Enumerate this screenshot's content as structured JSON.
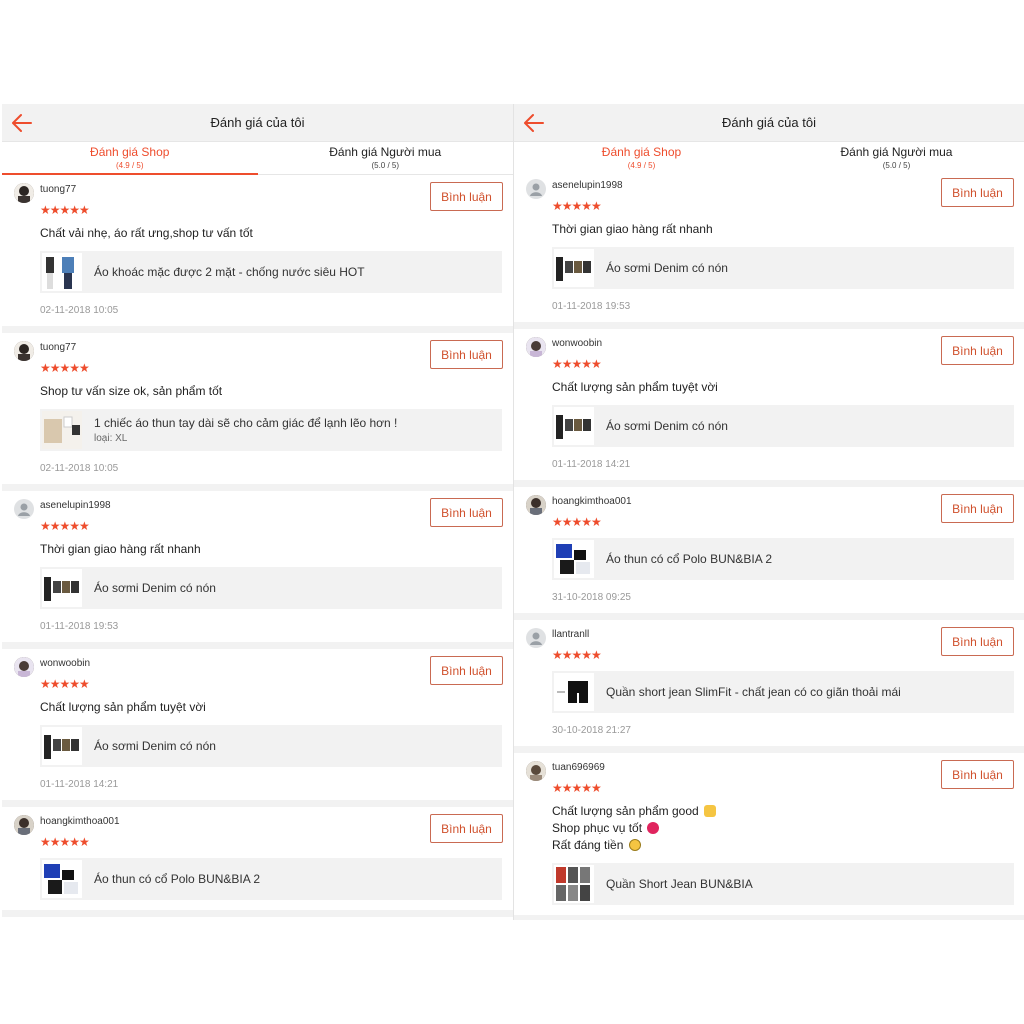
{
  "colors": {
    "accent": "#ee4d2d",
    "star": "#ee4d2d",
    "divider": "#f2f2f2"
  },
  "screens": [
    {
      "header": {
        "title": "Đánh giá của tôi"
      },
      "tabs": [
        {
          "label": "Đánh giá Shop",
          "score": "(4.9 / 5)",
          "active": true
        },
        {
          "label": "Đánh giá Người mua",
          "score": "(5.0 / 5)",
          "active": false
        }
      ],
      "reviews": [
        {
          "user": "tuong77",
          "stars": "★★★★★",
          "comment": [
            "Chất vải nhẹ, áo rất ưng,shop tư vấn tốt"
          ],
          "product": "Áo khoác mặc được 2 mặt - chống nước siêu HOT",
          "variant": "",
          "date": "02-11-2018 10:05",
          "button": "Bình luận"
        },
        {
          "user": "tuong77",
          "stars": "★★★★★",
          "comment": [
            "Shop tư vấn size ok, sản phẩm tốt"
          ],
          "product": "1 chiếc áo thun tay dài sẽ cho cảm giác để lạnh lẽo hơn !",
          "variant": "loại: XL",
          "date": "02-11-2018 10:05",
          "button": "Bình luận"
        },
        {
          "user": "asenelupin1998",
          "stars": "★★★★★",
          "comment": [
            "Thời gian giao hàng rất nhanh"
          ],
          "product": "Áo sơmi Denim có nón",
          "variant": "",
          "date": "01-11-2018 19:53",
          "button": "Bình luận"
        },
        {
          "user": "wonwoobin",
          "stars": "★★★★★",
          "comment": [
            "Chất lượng sản phẩm tuyệt vời"
          ],
          "product": "Áo sơmi Denim có nón",
          "variant": "",
          "date": "01-11-2018 14:21",
          "button": "Bình luận"
        },
        {
          "user": "hoangkimthoa001",
          "stars": "★★★★★",
          "comment": [],
          "product": "Áo thun có cổ Polo BUN&BIA 2",
          "variant": "",
          "date": "",
          "button": "Bình luận"
        }
      ]
    },
    {
      "header": {
        "title": "Đánh giá của tôi"
      },
      "tabs": [
        {
          "label": "Đánh giá Shop",
          "score": "(4.9 / 5)",
          "active": true
        },
        {
          "label": "Đánh giá Người mua",
          "score": "(5.0 / 5)",
          "active": false
        }
      ],
      "reviews": [
        {
          "user": "asenelupin1998",
          "stars": "★★★★★",
          "comment": [
            "Thời gian giao hàng rất nhanh"
          ],
          "product": "Áo sơmi Denim có nón",
          "variant": "",
          "date": "01-11-2018 19:53",
          "button": "Bình luận"
        },
        {
          "user": "wonwoobin",
          "stars": "★★★★★",
          "comment": [
            "Chất lượng sản phẩm tuyệt vời"
          ],
          "product": "Áo sơmi Denim có nón",
          "variant": "",
          "date": "01-11-2018 14:21",
          "button": "Bình luận"
        },
        {
          "user": "hoangkimthoa001",
          "stars": "★★★★★",
          "comment": [],
          "product": "Áo thun có cổ Polo BUN&BIA 2",
          "variant": "",
          "date": "31-10-2018 09:25",
          "button": "Bình luận"
        },
        {
          "user": "llantranll",
          "stars": "★★★★★",
          "comment": [],
          "product": "Quần short jean SlimFit - chất jean có co giãn thoải mái",
          "variant": "",
          "date": "30-10-2018 21:27",
          "button": "Bình luận"
        },
        {
          "user": "tuan696969",
          "stars": "★★★★★",
          "comment": [
            "Chất lượng sản phẩm good",
            "Shop phục vụ tốt",
            "Rất đáng tiền"
          ],
          "product": "Quần Short Jean BUN&BIA",
          "variant": "",
          "date": "",
          "button": "Bình luận"
        }
      ]
    }
  ]
}
